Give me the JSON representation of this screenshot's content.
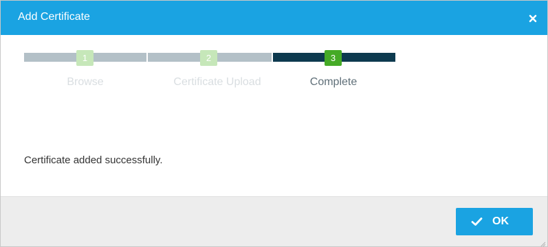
{
  "dialog": {
    "title": "Add Certificate",
    "close_icon": "close-icon"
  },
  "stepper": {
    "steps": [
      {
        "number": "1",
        "label": "Browse",
        "state": "completed"
      },
      {
        "number": "2",
        "label": "Certificate Upload",
        "state": "completed"
      },
      {
        "number": "3",
        "label": "Complete",
        "state": "current"
      }
    ]
  },
  "content": {
    "message": "Certificate added successfully."
  },
  "footer": {
    "ok_label": "OK",
    "ok_icon": "checkmark-icon"
  },
  "colors": {
    "accent": "#1aa3e2",
    "step_active": "#0d3a4f",
    "step_inactive": "#b3c0c7",
    "badge_current": "#45aa26",
    "badge_pending": "#c6e7b9"
  }
}
